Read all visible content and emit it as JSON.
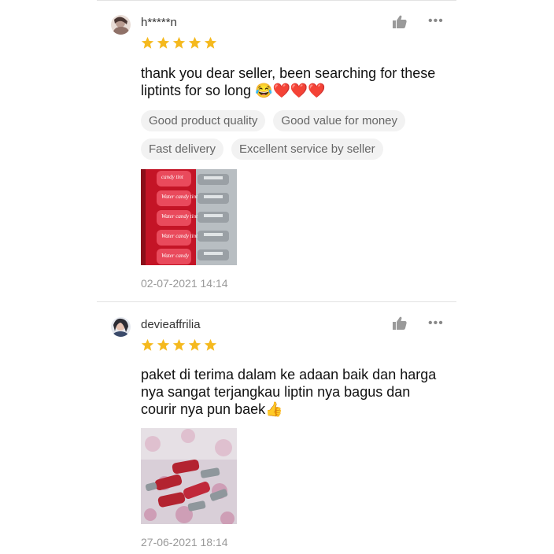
{
  "reviews": [
    {
      "username": "h*****n",
      "rating": 5,
      "text": "thank you dear seller, been searching for these liptints for so long 😂❤️❤️❤️",
      "tags": [
        "Good product quality",
        "Good value for money",
        "Fast delivery",
        "Excellent service by seller"
      ],
      "date": "02-07-2021 14:14",
      "photo_labels": [
        "candy tint",
        "Water candy tint",
        "Water candy tint",
        "Water candy tint",
        "Water candy"
      ]
    },
    {
      "username": "devieaffrilia",
      "rating": 5,
      "text": "paket di terima dalam ke adaan baik dan harga nya sangat terjangkau liptin nya bagus dan courir nya pun baek👍",
      "tags": [],
      "date": "27-06-2021 18:14"
    }
  ],
  "icons": {
    "like": "thumbs-up-icon",
    "more": "more-options-icon",
    "star": "star-icon"
  },
  "colors": {
    "star": "#f5b91e",
    "tag_bg": "#f2f2f2",
    "tag_text": "#666666",
    "date": "#999999",
    "icon": "#9a9a9a"
  },
  "more_glyph": "•••"
}
